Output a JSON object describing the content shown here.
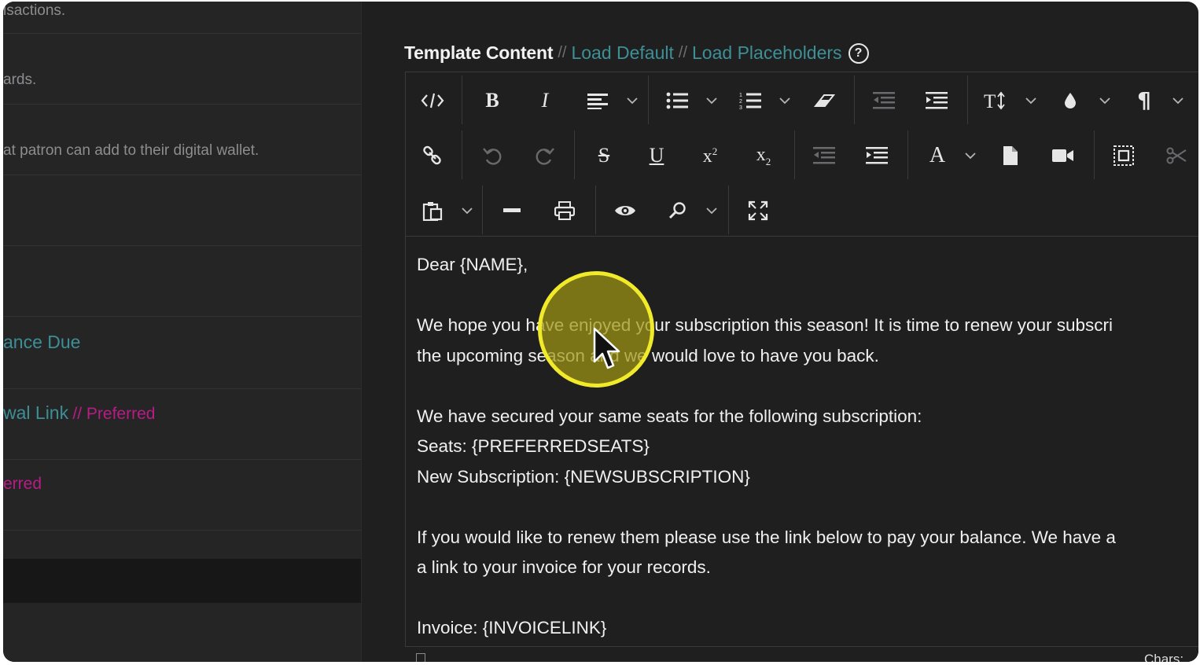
{
  "left_panel": {
    "rows": [
      {
        "text": "isactions.",
        "style": "muted"
      },
      {
        "text": "ards.",
        "style": "muted"
      },
      {
        "text": "at patron can add to their digital wallet.",
        "style": "muted"
      }
    ],
    "links": [
      {
        "text": "ance Due"
      },
      {
        "text": "wal Link",
        "suffix": "// Preferred"
      },
      {
        "text": "erred"
      }
    ]
  },
  "header": {
    "title": "Template Content",
    "separator": "//",
    "load_default": "Load Default",
    "load_placeholders": "Load Placeholders",
    "help": "?"
  },
  "toolbar": {
    "row1": [
      "code-view",
      "bold",
      "italic",
      "align",
      "unordered-list",
      "ordered-list",
      "clear-format",
      "outdent",
      "indent",
      "font-size",
      "color",
      "paragraph"
    ],
    "row2": [
      "link",
      "undo",
      "redo",
      "strikethrough",
      "underline",
      "superscript",
      "subscript",
      "outdent",
      "indent",
      "font-color",
      "insert-file",
      "insert-video",
      "select-all",
      "cut"
    ],
    "row3": [
      "paste",
      "horizontal-rule",
      "print",
      "preview",
      "find",
      "fullscreen"
    ]
  },
  "content": {
    "lines": [
      "Dear {NAME},",
      "",
      "We hope you have enjoyed your subscription this season! It is time to renew your subscri",
      "the upcoming season and we would love to have you back.",
      "",
      "We have secured your same seats for the following subscription:",
      "Seats: {PREFERREDSEATS}",
      "New Subscription: {NEWSUBSCRIPTION}",
      "",
      "If you would like to renew them please use the link below to pay your balance. We have a",
      "a link to your invoice for your records.",
      "",
      "Invoice: {INVOICELINK}"
    ]
  },
  "status": {
    "chars_label": "Chars:"
  },
  "colors": {
    "background": "#1f1f20",
    "link": "#3e8f96",
    "preferred": "#b81c85",
    "highlight": "#f0ea2a"
  }
}
